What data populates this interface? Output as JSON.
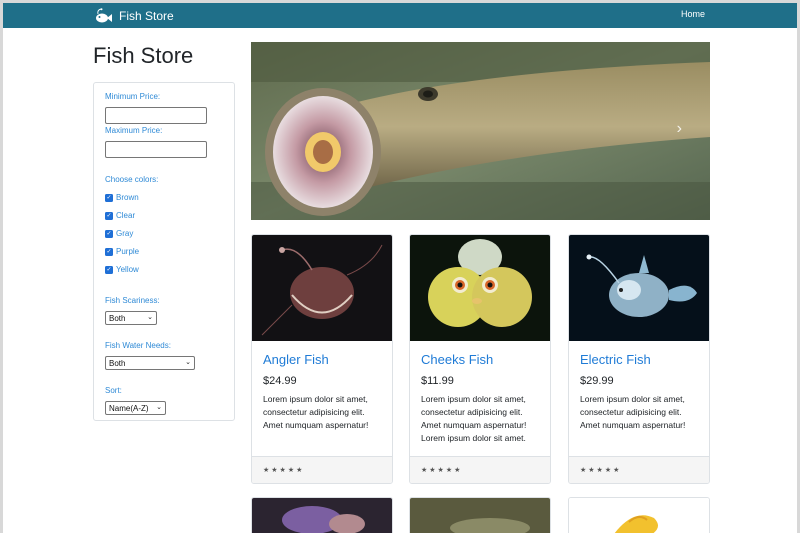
{
  "navbar": {
    "brand": "Fish Store",
    "home": "Home"
  },
  "page_title": "Fish Store",
  "filters": {
    "min_price_label": "Minimum Price:",
    "min_price_value": "",
    "max_price_label": "Maximum Price:",
    "max_price_value": "",
    "colors_label": "Choose colors:",
    "colors": [
      {
        "label": "Brown",
        "checked": true
      },
      {
        "label": "Clear",
        "checked": true
      },
      {
        "label": "Gray",
        "checked": true
      },
      {
        "label": "Purple",
        "checked": true
      },
      {
        "label": "Yellow",
        "checked": true
      }
    ],
    "scariness_label": "Fish Scariness:",
    "scariness_value": "Both",
    "water_label": "Fish Water Needs:",
    "water_value": "Both",
    "sort_label": "Sort:",
    "sort_value": "Name(A-Z)"
  },
  "carousel": {
    "slide_count": 3,
    "active_slide": 3,
    "next_icon": "chevron-right-icon"
  },
  "products": [
    {
      "name": "Angler Fish",
      "price": "$24.99",
      "description": "Lorem ipsum dolor sit amet, consectetur adipisicing elit. Amet numquam aspernatur!",
      "rating": "★★★★★"
    },
    {
      "name": "Cheeks Fish",
      "price": "$11.99",
      "description": "Lorem ipsum dolor sit amet, consectetur adipisicing elit. Amet numquam aspernatur! Lorem ipsum dolor sit amet.",
      "rating": "★★★★★"
    },
    {
      "name": "Electric Fish",
      "price": "$29.99",
      "description": "Lorem ipsum dolor sit amet, consectetur adipisicing elit. Amet numquam aspernatur!",
      "rating": "★★★★★"
    }
  ],
  "colors": {
    "navbar": "#1f6f89",
    "link": "#1f7bd6",
    "label": "#2f8ad6"
  }
}
